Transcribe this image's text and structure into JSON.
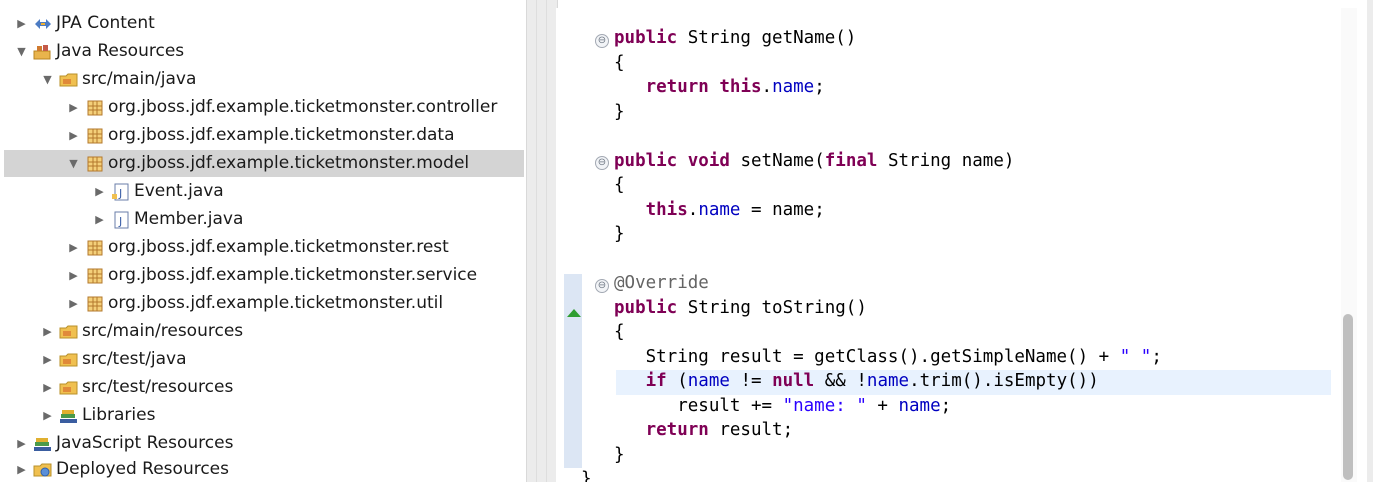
{
  "explorer": {
    "items": [
      {
        "label": "JPA Content",
        "icon": "jpa-content-icon",
        "expanded": false,
        "selected": false
      },
      {
        "label": "Java Resources",
        "icon": "java-resources-icon",
        "expanded": true,
        "selected": false
      },
      {
        "label": "src/main/java",
        "icon": "source-folder-icon",
        "expanded": true,
        "selected": false
      },
      {
        "label": "org.jboss.jdf.example.ticketmonster.controller",
        "icon": "package-icon",
        "expanded": false,
        "selected": false
      },
      {
        "label": "org.jboss.jdf.example.ticketmonster.data",
        "icon": "package-icon",
        "expanded": false,
        "selected": false
      },
      {
        "label": "org.jboss.jdf.example.ticketmonster.model",
        "icon": "package-icon",
        "expanded": true,
        "selected": true
      },
      {
        "label": "Event.java",
        "icon": "java-file-icon",
        "expanded": false,
        "selected": false
      },
      {
        "label": "Member.java",
        "icon": "java-file-icon",
        "expanded": false,
        "selected": false
      },
      {
        "label": "org.jboss.jdf.example.ticketmonster.rest",
        "icon": "package-icon",
        "expanded": false,
        "selected": false
      },
      {
        "label": "org.jboss.jdf.example.ticketmonster.service",
        "icon": "package-icon",
        "expanded": false,
        "selected": false
      },
      {
        "label": "org.jboss.jdf.example.ticketmonster.util",
        "icon": "package-icon",
        "expanded": false,
        "selected": false
      },
      {
        "label": "src/main/resources",
        "icon": "source-folder-icon",
        "expanded": false,
        "selected": false
      },
      {
        "label": "src/test/java",
        "icon": "source-folder-icon",
        "expanded": false,
        "selected": false
      },
      {
        "label": "src/test/resources",
        "icon": "source-folder-icon",
        "expanded": false,
        "selected": false
      },
      {
        "label": "Libraries",
        "icon": "libraries-icon",
        "expanded": false,
        "selected": false
      },
      {
        "label": "JavaScript Resources",
        "icon": "libraries-icon",
        "expanded": false,
        "selected": false
      },
      {
        "label": "Deployed Resources",
        "icon": "deployed-resources-icon",
        "expanded": false,
        "selected": false
      }
    ]
  },
  "editor": {
    "lines": [
      [
        [
          "kw",
          "public"
        ],
        [
          "t",
          " String getName()"
        ]
      ],
      [
        [
          "t",
          "{"
        ]
      ],
      [
        [
          "t",
          "   "
        ],
        [
          "kw",
          "return"
        ],
        [
          "t",
          " "
        ],
        [
          "kw",
          "this"
        ],
        [
          "t",
          "."
        ],
        [
          "fld",
          "name"
        ],
        [
          "t",
          ";"
        ]
      ],
      [
        [
          "t",
          "}"
        ]
      ],
      [
        [
          "t",
          ""
        ]
      ],
      [
        [
          "kw",
          "public"
        ],
        [
          "t",
          " "
        ],
        [
          "kw",
          "void"
        ],
        [
          "t",
          " setName("
        ],
        [
          "kw",
          "final"
        ],
        [
          "t",
          " String name)"
        ]
      ],
      [
        [
          "t",
          "{"
        ]
      ],
      [
        [
          "t",
          "   "
        ],
        [
          "kw",
          "this"
        ],
        [
          "t",
          "."
        ],
        [
          "fld",
          "name"
        ],
        [
          "t",
          " = name;"
        ]
      ],
      [
        [
          "t",
          "}"
        ]
      ],
      [
        [
          "t",
          ""
        ]
      ],
      [
        [
          "ann",
          "@Override"
        ]
      ],
      [
        [
          "kw",
          "public"
        ],
        [
          "t",
          " String toString()"
        ]
      ],
      [
        [
          "t",
          "{"
        ]
      ],
      [
        [
          "t",
          "   String result = getClass().getSimpleName() + "
        ],
        [
          "str",
          "\" \""
        ],
        [
          "t",
          ";"
        ]
      ],
      [
        [
          "t",
          "   "
        ],
        [
          "kw",
          "if"
        ],
        [
          "t",
          " ("
        ],
        [
          "fld",
          "name"
        ],
        [
          "t",
          " != "
        ],
        [
          "kw",
          "null"
        ],
        [
          "t",
          " && !"
        ],
        [
          "fld",
          "name"
        ],
        [
          "t",
          ".trim().isEmpty())"
        ]
      ],
      [
        [
          "t",
          "      result += "
        ],
        [
          "str",
          "\"name: \""
        ],
        [
          "t",
          " + "
        ],
        [
          "fld",
          "name"
        ],
        [
          "t",
          ";"
        ]
      ],
      [
        [
          "t",
          "   "
        ],
        [
          "kw",
          "return"
        ],
        [
          "t",
          " result;"
        ]
      ],
      [
        [
          "t",
          "}"
        ]
      ],
      [
        [
          "t",
          "}"
        ]
      ]
    ],
    "fold_markers": [
      "⊖",
      "⊖",
      "⊖"
    ],
    "colors": {
      "keyword": "#7f0055",
      "field": "#0000c0",
      "string": "#2a00ff",
      "annotation": "#646464",
      "current_line": "#e8f2fe",
      "selection": "#d4d4d4"
    }
  }
}
